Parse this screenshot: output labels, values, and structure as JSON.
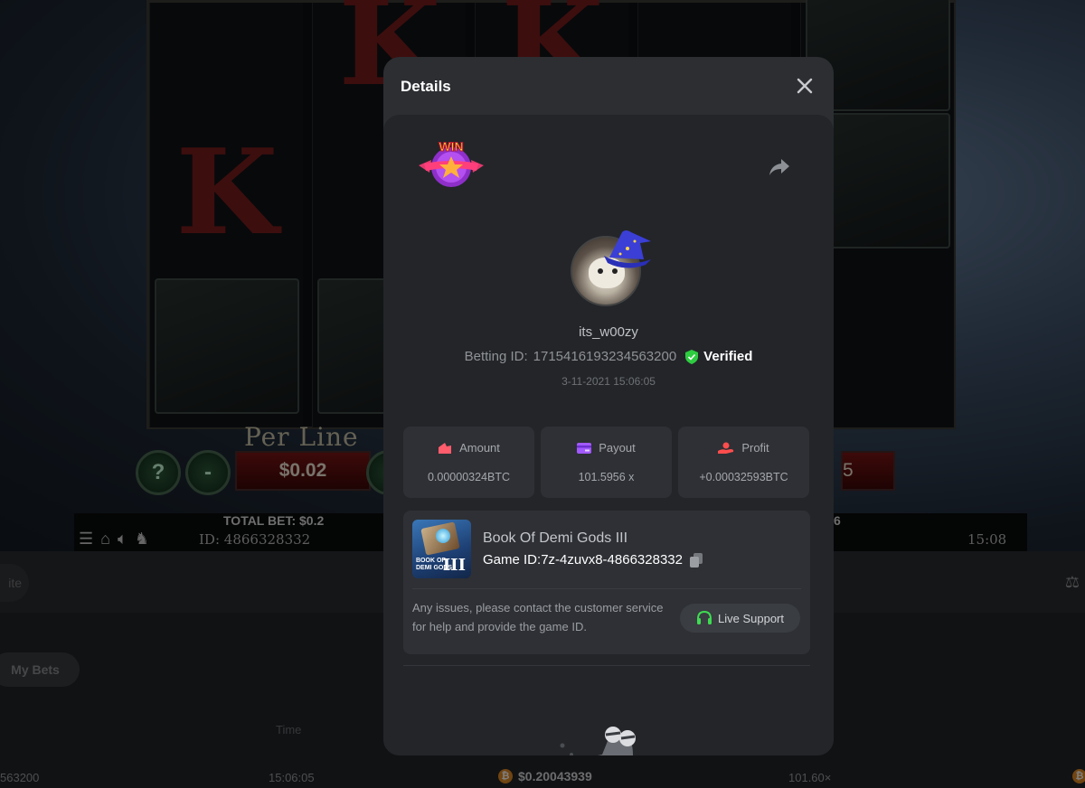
{
  "background_game": {
    "per_line_label": "Per Line",
    "per_line_value": "$0.02",
    "minus_label": "-",
    "question_label": "?",
    "right_box_partial": "5",
    "total_bet": "TOTAL BET: $0.2",
    "right_partial_value": "6",
    "game_id_line": "ID: 4866328332",
    "clock": "15:08"
  },
  "page": {
    "pill_partial": "ite",
    "my_bets_button": "My Bets",
    "col_time_header": "Time",
    "row": {
      "bet_id_partial": "563200",
      "time": "15:06:05",
      "amount": "$0.20043939",
      "multiplier": "101.60×"
    }
  },
  "modal": {
    "title": "Details",
    "username": "its_w00zy",
    "betting_id_label": "Betting ID:",
    "betting_id": "1715416193234563200",
    "verified_label": "Verified",
    "date": "3-11-2021 15:06:05",
    "win_badge_text": "WIN",
    "stats": [
      {
        "label": "Amount",
        "value": "0.00000324BTC",
        "icon": "wallet-icon",
        "color": "#ff5c6c"
      },
      {
        "label": "Payout",
        "value": "101.5956 x",
        "icon": "card-icon",
        "color": "#a259ff"
      },
      {
        "label": "Profit",
        "value": "+0.00032593BTC",
        "icon": "hand-coin-icon",
        "color": "#ff4d4d"
      }
    ],
    "game": {
      "name": "Book Of Demi Gods III",
      "id_label": "Game ID:",
      "id_value": "7z-4zuvx8-4866328332",
      "thumb_text_line1": "BOOK OF",
      "thumb_text_line2": "DEMI GODS",
      "thumb_numeral": "III"
    },
    "support_text": "Any issues, please contact the customer service for help and provide the game ID.",
    "live_support_label": "Live Support"
  },
  "colors": {
    "verified_green": "#2ecc40",
    "headset_green": "#3ddc51"
  }
}
